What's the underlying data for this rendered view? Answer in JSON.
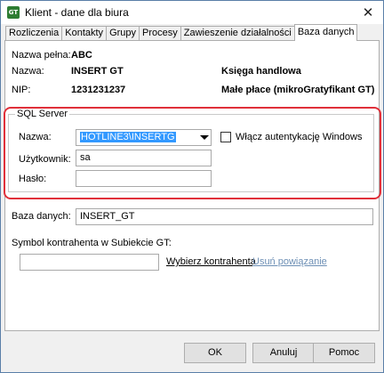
{
  "window": {
    "title": "Klient - dane dla biura",
    "icon": "insert-gt-icon",
    "close_glyph": "✕"
  },
  "tabs": [
    {
      "label": "Rozliczenia"
    },
    {
      "label": "Kontakty"
    },
    {
      "label": "Grupy"
    },
    {
      "label": "Procesy"
    },
    {
      "label": "Zawieszenie działalności"
    },
    {
      "label": "Baza danych",
      "active": true
    }
  ],
  "info": {
    "name_full_label": "Nazwa pełna:",
    "name_full_value": "ABC",
    "name_label": "Nazwa:",
    "name_value": "INSERT GT",
    "nip_label": "NIP:",
    "nip_value": "1231231237",
    "accounting_value": "Księga handlowa",
    "payroll_value": "Małe płace (mikroGratyfikant GT)"
  },
  "sql_server": {
    "group_title": "SQL Server",
    "name_label": "Nazwa:",
    "name_value": "HOTLINE3\\INSERTG",
    "windows_auth_label": "Włącz autentykację Windows",
    "windows_auth_checked": false,
    "user_label": "Użytkownik:",
    "user_value": "sa",
    "password_label": "Hasło:",
    "password_value": ""
  },
  "database": {
    "label": "Baza danych:",
    "value": "INSERT_GT"
  },
  "contractor": {
    "label": "Symbol kontrahenta w Subiekcie GT:",
    "value": "",
    "choose_link": "Wybierz kontrahenta",
    "remove_link": "Usuń powiązanie"
  },
  "buttons": {
    "ok": "OK",
    "cancel": "Anuluj",
    "help": "Pomoc"
  },
  "colors": {
    "highlight": "#e0303a",
    "selection": "#3399ff"
  }
}
